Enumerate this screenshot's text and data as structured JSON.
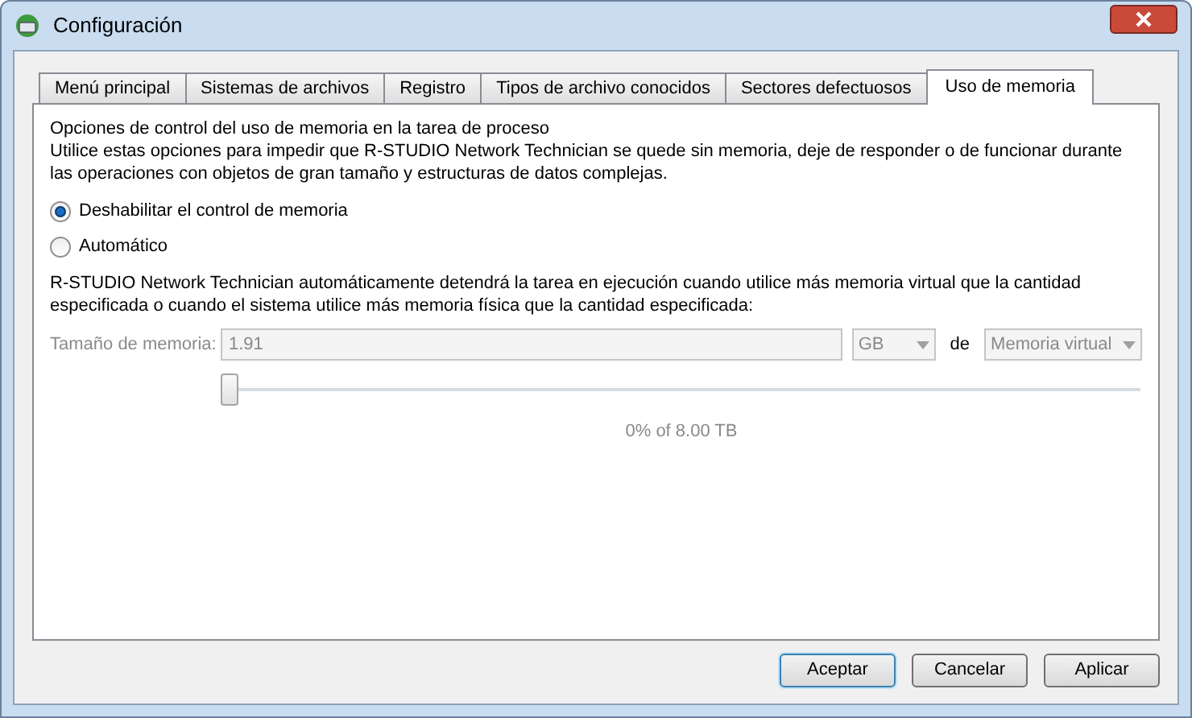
{
  "window": {
    "title": "Configuración"
  },
  "tabs": [
    {
      "label": "Menú principal",
      "selected": false
    },
    {
      "label": "Sistemas de archivos",
      "selected": false
    },
    {
      "label": "Registro",
      "selected": false
    },
    {
      "label": "Tipos de archivo conocidos",
      "selected": false
    },
    {
      "label": "Sectores defectuosos",
      "selected": false
    },
    {
      "label": "Uso de memoria",
      "selected": true
    }
  ],
  "intro": [
    "Opciones de control del uso de memoria en la tarea de proceso",
    "Utilice estas opciones para impedir que R-STUDIO Network Technician se quede sin memoria, deje de responder o de funcionar durante las operaciones con objetos de gran tamaño y estructuras de datos complejas."
  ],
  "options": [
    {
      "label": "Deshabilitar el control de memoria",
      "selected": true
    },
    {
      "label": "Automático",
      "selected": false
    }
  ],
  "automatic_note": "R-STUDIO Network Technician automáticamente detendrá la tarea en ejecución cuando utilice más memoria virtual que la cantidad especificada o cuando el sistema utilice más memoria física que la cantidad especificada:",
  "memory": {
    "label": "Tamaño de memoria:",
    "value": "1.91",
    "unit": "GB",
    "of_label": "de",
    "type": "Memoria virtual",
    "disabled": true,
    "level": 0,
    "reading": "0% of 8.00 TB"
  },
  "buttons": [
    {
      "label": "Aceptar",
      "default": true
    },
    {
      "label": "Cancelar",
      "default": false
    },
    {
      "label": "Aplicar",
      "default": false
    }
  ]
}
